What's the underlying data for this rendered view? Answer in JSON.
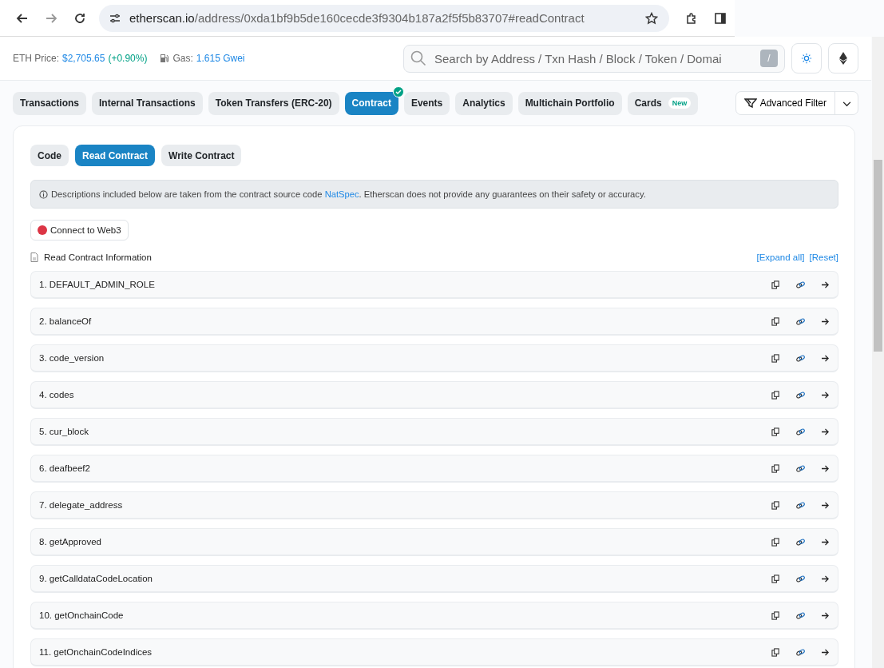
{
  "browser": {
    "url_host": "etherscan.io",
    "url_path": "/address/0xda1bf9b5de160cecde3f9304b187a2f5f5b83707#readContract"
  },
  "header": {
    "price_label": "ETH Price:",
    "price": "$2,705.65",
    "change": "(+0.90%)",
    "gas_label": "Gas:",
    "gas": "1.615 Gwei",
    "search_placeholder": "Search by Address / Txn Hash / Block / Token / Domai",
    "search_key": "/"
  },
  "tabs": [
    {
      "label": "Transactions",
      "selected": false
    },
    {
      "label": "Internal Transactions",
      "selected": false
    },
    {
      "label": "Token Transfers (ERC-20)",
      "selected": false
    },
    {
      "label": "Contract",
      "selected": true,
      "verified": true
    },
    {
      "label": "Events",
      "selected": false
    },
    {
      "label": "Analytics",
      "selected": false
    },
    {
      "label": "Multichain Portfolio",
      "selected": false
    },
    {
      "label": "Cards",
      "selected": false,
      "badge": "New"
    }
  ],
  "advanced_filter": "Advanced Filter",
  "subtabs": [
    {
      "label": "Code",
      "selected": false
    },
    {
      "label": "Read Contract",
      "selected": true
    },
    {
      "label": "Write Contract",
      "selected": false
    }
  ],
  "notice": {
    "before": "Descriptions included below are taken from the contract source code ",
    "link": "NatSpec",
    "after": ". Etherscan does not provide any guarantees on their safety or accuracy."
  },
  "connect": {
    "label": "Connect to Web3",
    "color": "#dc3545"
  },
  "section_title": "Read Contract Information",
  "expand_all": "[Expand all]",
  "reset": "[Reset]",
  "functions": [
    "1. DEFAULT_ADMIN_ROLE",
    "2. balanceOf",
    "3. code_version",
    "4. codes",
    "5. cur_block",
    "6. deafbeef2",
    "7. delegate_address",
    "8. getApproved",
    "9. getCalldataCodeLocation",
    "10. getOnchainCode",
    "11. getOnchainCodeIndices"
  ]
}
